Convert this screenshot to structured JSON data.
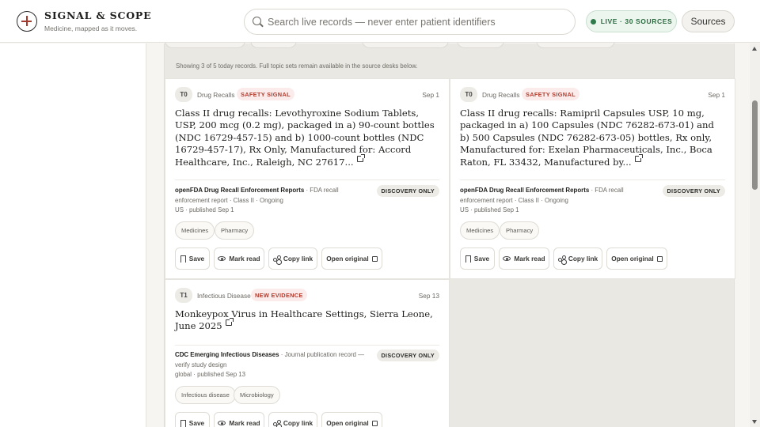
{
  "brand": {
    "title": "SIGNAL & SCOPE",
    "tagline": "Medicine, mapped as it moves."
  },
  "search": {
    "placeholder": "Search live records — never enter patient identifiers"
  },
  "status": {
    "live_label": "LIVE · 30 SOURCES",
    "sources_button": "Sources"
  },
  "notice": "Showing 3 of 5 today records. Full topic sets remain available in the source desks below.",
  "cards": [
    {
      "tier": "T0",
      "category": "Drug Recalls",
      "signal": "SAFETY SIGNAL",
      "date": "Sep 1",
      "title": "Class II drug recalls: Levothyroxine Sodium Tablets, USP, 200 mcg (0.2 mg), packaged in a) 90-count bottles (NDC 16729-457-15) and b) 1000-count bottles (NDC 16729-457-17), Rx Only, Manufactured for: Accord Healthcare, Inc., Raleigh, NC 27617...",
      "source_name": "openFDA Drug Recall Enforcement Reports",
      "source_detail": " · FDA recall enforcement report · Class II · Ongoing",
      "source_meta": "US · published Sep 1",
      "discovery": "DISCOVERY ONLY",
      "tags": [
        "Medicines",
        "Pharmacy"
      ],
      "actions": {
        "save": "Save",
        "mark_read": "Mark read",
        "copy_link": "Copy link",
        "open_original": "Open original"
      }
    },
    {
      "tier": "T0",
      "category": "Drug Recalls",
      "signal": "SAFETY SIGNAL",
      "date": "Sep 1",
      "title": "Class II drug recalls: Ramipril Capsules USP, 10 mg, packaged in a) 100 Capsules (NDC 76282-673-01) and b) 500 Capsules (NDC 76282-673-05) bottles, Rx only, Manufactured for: Exelan Pharmaceuticals, Inc., Boca Raton, FL 33432, Manufactured by...",
      "source_name": "openFDA Drug Recall Enforcement Reports",
      "source_detail": " · FDA recall enforcement report · Class II · Ongoing",
      "source_meta": "US · published Sep 1",
      "discovery": "DISCOVERY ONLY",
      "tags": [
        "Medicines",
        "Pharmacy"
      ],
      "actions": {
        "save": "Save",
        "mark_read": "Mark read",
        "copy_link": "Copy link",
        "open_original": "Open original"
      }
    },
    {
      "tier": "T1",
      "category": "Infectious Disease",
      "signal": "NEW EVIDENCE",
      "date": "Sep 13",
      "title": "Monkeypox Virus in Healthcare Settings, Sierra Leone, June 2025",
      "source_name": "CDC Emerging Infectious Diseases",
      "source_detail": " · Journal publication record — verify study design",
      "source_meta": "global · published Sep 13",
      "discovery": "DISCOVERY ONLY",
      "tags": [
        "Infectious disease",
        "Microbiology"
      ],
      "actions": {
        "save": "Save",
        "mark_read": "Mark read",
        "copy_link": "Copy link",
        "open_original": "Open original"
      }
    }
  ]
}
